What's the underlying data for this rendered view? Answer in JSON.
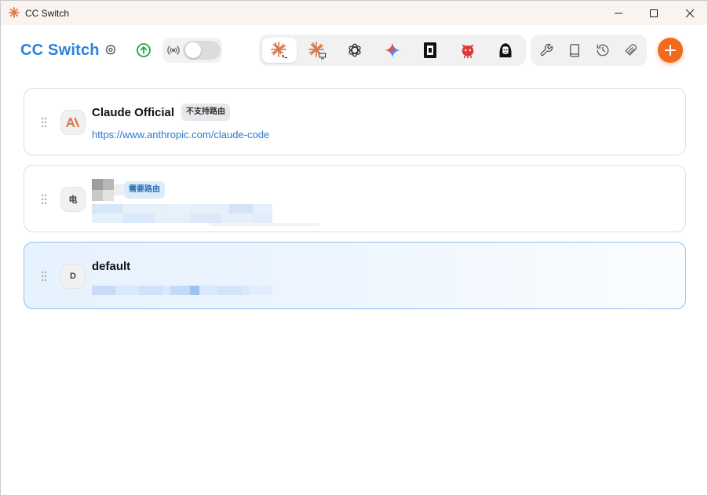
{
  "window": {
    "title": "CC Switch",
    "controls": [
      "minimize-icon",
      "maximize-icon",
      "close-icon"
    ]
  },
  "header": {
    "title": "CC Switch",
    "settings_icon": "gear-icon",
    "update_icon": "arrow-up-circle-icon",
    "proxy": {
      "icon": "broadcast-icon",
      "enabled": false
    }
  },
  "app_tabs": [
    {
      "id": "claude-code",
      "icon": "claude-code-icon",
      "active": true
    },
    {
      "id": "claude-desktop",
      "icon": "claude-desktop-icon",
      "active": false
    },
    {
      "id": "openai",
      "icon": "openai-icon",
      "active": false
    },
    {
      "id": "gemini",
      "icon": "gemini-icon",
      "active": false
    },
    {
      "id": "dark-app",
      "icon": "square-app-icon",
      "active": false
    },
    {
      "id": "red-mascot",
      "icon": "red-mascot-icon",
      "active": false
    },
    {
      "id": "avatar-app",
      "icon": "avatar-app-icon",
      "active": false
    }
  ],
  "tools": [
    "wrench-icon",
    "book-icon",
    "history-icon",
    "skills-icon"
  ],
  "add_button_icon": "plus-icon",
  "colors": {
    "title_blue": "#2b82d9",
    "accent_orange": "#f26b1d",
    "active_card_bg": "#e6f2fe",
    "active_card_border": "#8ec0ef",
    "link_blue": "#2a7bd2"
  },
  "providers": [
    {
      "name": "Claude Official",
      "badge": "不支持路由",
      "url": "https://www.anthropic.com/claude-code",
      "avatar_icon": "anthropic-logo-icon",
      "active": false
    },
    {
      "name": "",
      "badge": "需要路由",
      "url": "",
      "avatar_text": "电",
      "redacted": true,
      "active": false
    },
    {
      "name": "default",
      "badge": "",
      "url": "",
      "avatar_text": "D",
      "redacted": true,
      "active": true
    }
  ]
}
